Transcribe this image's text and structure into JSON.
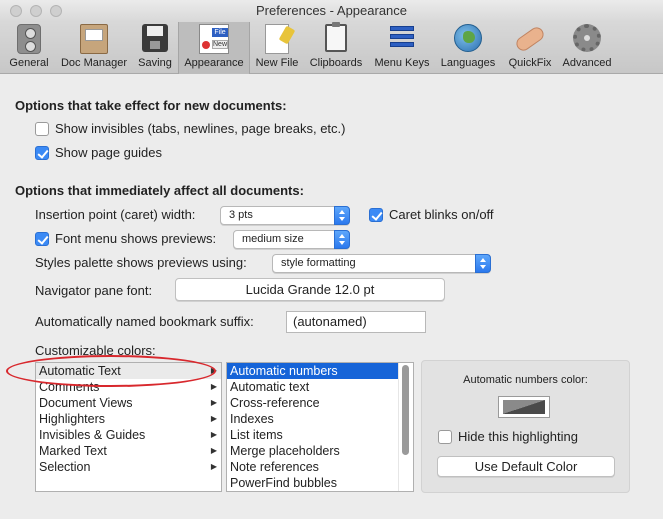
{
  "window": {
    "title": "Preferences - Appearance"
  },
  "toolbar": {
    "items": [
      {
        "label": "General",
        "icon": "general-icon"
      },
      {
        "label": "Doc Manager",
        "icon": "doc-manager-icon"
      },
      {
        "label": "Saving",
        "icon": "saving-icon"
      },
      {
        "label": "Appearance",
        "icon": "appearance-icon",
        "selected": true,
        "icon_text_top": "File",
        "icon_text_bottom": "New"
      },
      {
        "label": "New File",
        "icon": "new-file-icon"
      },
      {
        "label": "Clipboards",
        "icon": "clipboard-icon"
      },
      {
        "label": "Menu Keys",
        "icon": "menu-keys-icon"
      },
      {
        "label": "Languages",
        "icon": "globe-icon"
      },
      {
        "label": "QuickFix",
        "icon": "bandage-icon"
      },
      {
        "label": "Advanced",
        "icon": "gear-icon"
      }
    ]
  },
  "new_docs": {
    "title": "Options that take effect for new documents:",
    "show_invisibles": {
      "label": "Show invisibles (tabs, newlines, page breaks, etc.)",
      "checked": false
    },
    "show_page_guides": {
      "label": "Show page guides",
      "checked": true
    }
  },
  "all_docs": {
    "title": "Options that immediately affect all documents:",
    "caret_width": {
      "label": "Insertion point (caret) width:",
      "value": "3 pts"
    },
    "caret_blinks": {
      "label": "Caret blinks on/off",
      "checked": true
    },
    "font_previews": {
      "label": "Font menu shows previews:",
      "checked": true,
      "value": "medium size"
    },
    "styles_palette": {
      "label": "Styles palette shows previews using:",
      "value": "style formatting"
    },
    "navigator_font": {
      "label": "Navigator pane font:",
      "value": "Lucida Grande 12.0 pt"
    },
    "bookmark_suffix": {
      "label": "Automatically named bookmark suffix:",
      "value": "(autonamed)"
    }
  },
  "colors": {
    "label": "Customizable colors:",
    "categories": [
      "Automatic Text",
      "Comments",
      "Document Views",
      "Highlighters",
      "Invisibles & Guides",
      "Marked Text",
      "Selection"
    ],
    "items": [
      "Automatic numbers",
      "Automatic text",
      "Cross-reference",
      "Indexes",
      "List items",
      "Merge placeholders",
      "Note references",
      "PowerFind bubbles"
    ],
    "panel": {
      "color_label": "Automatic numbers color:",
      "hide_highlighting": {
        "label": "Hide this highlighting",
        "checked": false
      },
      "default_button": "Use Default Color"
    }
  },
  "accent_color": "#1664d8",
  "annotation_color": "#d8282d"
}
